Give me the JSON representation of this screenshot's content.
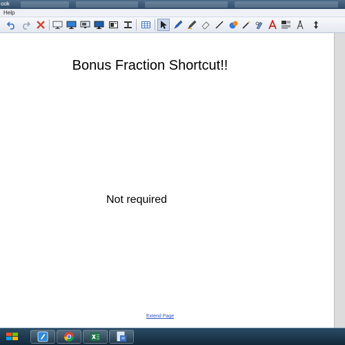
{
  "window": {
    "title_fragment": "ook"
  },
  "menu": {
    "items": [
      "Help"
    ]
  },
  "toolbar": {
    "buttons": [
      "undo-icon",
      "redo-icon",
      "delete-icon",
      "screen-shade-icon",
      "display-icon",
      "capture-screen-icon",
      "capture-window-icon",
      "capture-area-icon",
      "screen-capture-toolbar-icon",
      "table-icon",
      "select-arrow-icon",
      "pen-icon",
      "creative-pen-icon",
      "eraser-icon",
      "line-icon",
      "fill-icon",
      "magic-pen-icon",
      "shape-recognition-pen-icon",
      "text-icon",
      "properties-icon",
      "measurement-tools-icon",
      "more-tools-icon"
    ]
  },
  "canvas": {
    "heading": "Bonus Fraction Shortcut!!",
    "note": "Not required",
    "extend_link": "Extend Page"
  },
  "taskbar": {
    "items": [
      "start-icon",
      "network-icon",
      "notebook-app-icon",
      "chrome-icon",
      "excel-icon",
      "document-app-icon"
    ]
  }
}
